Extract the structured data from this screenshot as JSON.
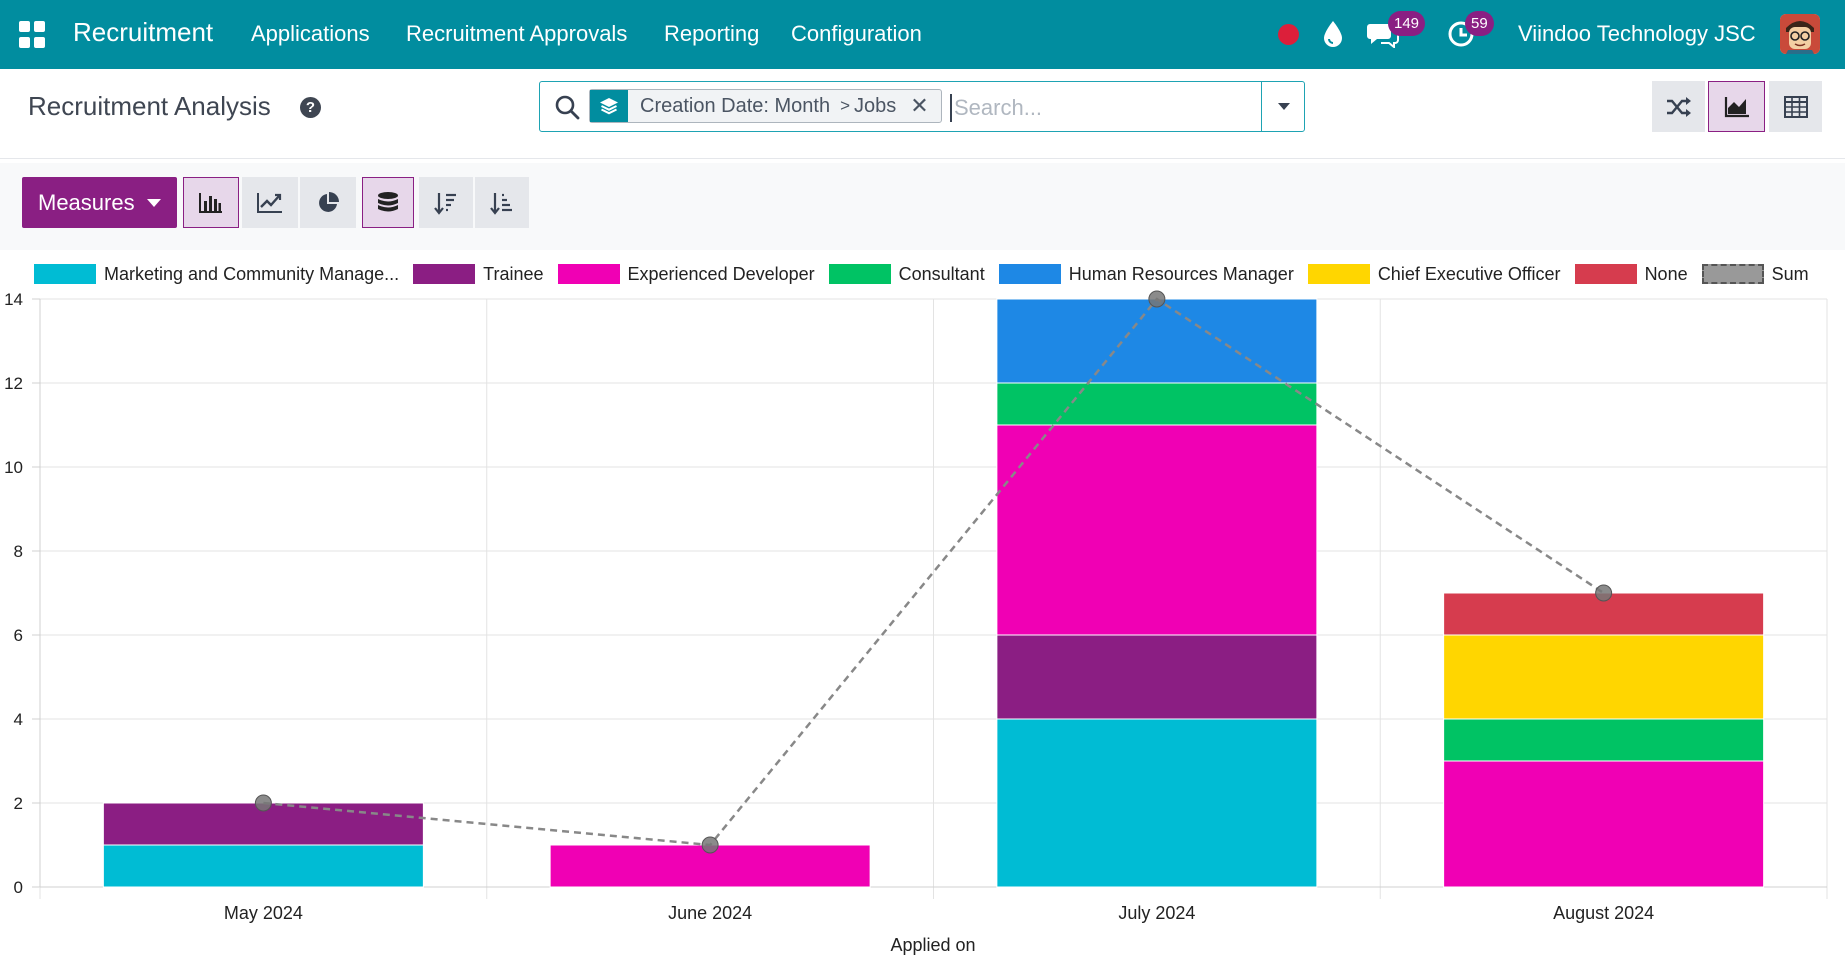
{
  "navbar": {
    "brand": "Recruitment",
    "menu": [
      "Applications",
      "Recruitment Approvals",
      "Reporting",
      "Configuration"
    ],
    "messages_count": "149",
    "activities_count": "59",
    "company": "Viindoo Technology JSC",
    "colors": {
      "bar": "#018d9f",
      "badge": "#8a1f83",
      "record": "#dc1f3a"
    }
  },
  "control": {
    "title": "Recruitment Analysis",
    "facet": {
      "field": "Creation Date: Month",
      "separator": ">",
      "value": "Jobs"
    },
    "search_placeholder": "Search...",
    "views": [
      "shuffle-icon",
      "graph-view-icon",
      "pivot-view-icon"
    ],
    "active_view": "graph-view-icon"
  },
  "toolbar": {
    "measures_label": "Measures",
    "buttons": [
      "bar-chart-icon",
      "line-chart-icon",
      "pie-chart-icon",
      "stacked-icon",
      "sort-descending-icon",
      "sort-ascending-icon"
    ],
    "active": [
      "bar-chart-icon",
      "stacked-icon"
    ],
    "accent": "#8a1f83"
  },
  "chart_data": {
    "type": "bar",
    "stacked": true,
    "categories": [
      "May 2024",
      "June 2024",
      "July 2024",
      "August 2024"
    ],
    "xlabel": "Applied on",
    "ylabel": "",
    "ylim": [
      0,
      14
    ],
    "yticks": [
      0,
      2,
      4,
      6,
      8,
      10,
      12,
      14
    ],
    "grid": true,
    "legend_position": "top",
    "series": [
      {
        "name": "Marketing and Community Manage...",
        "color": "#00bcd4",
        "values": [
          1,
          0,
          4,
          0
        ]
      },
      {
        "name": "Trainee",
        "color": "#8b1e83",
        "values": [
          1,
          0,
          2,
          0
        ]
      },
      {
        "name": "Experienced Developer",
        "color": "#f000b4",
        "values": [
          0,
          1,
          5,
          3
        ]
      },
      {
        "name": "Consultant",
        "color": "#00c364",
        "values": [
          0,
          0,
          1,
          1
        ]
      },
      {
        "name": "Human Resources Manager",
        "color": "#1e88e5",
        "values": [
          0,
          0,
          2,
          0
        ]
      },
      {
        "name": "Chief Executive Officer",
        "color": "#ffd600",
        "values": [
          0,
          0,
          0,
          2
        ]
      },
      {
        "name": "None",
        "color": "#d63c4e",
        "values": [
          0,
          0,
          0,
          1
        ]
      }
    ],
    "sum_series": {
      "name": "Sum",
      "color": "#888888",
      "values": [
        2,
        1,
        14,
        7
      ],
      "style": "dashed-line"
    }
  }
}
